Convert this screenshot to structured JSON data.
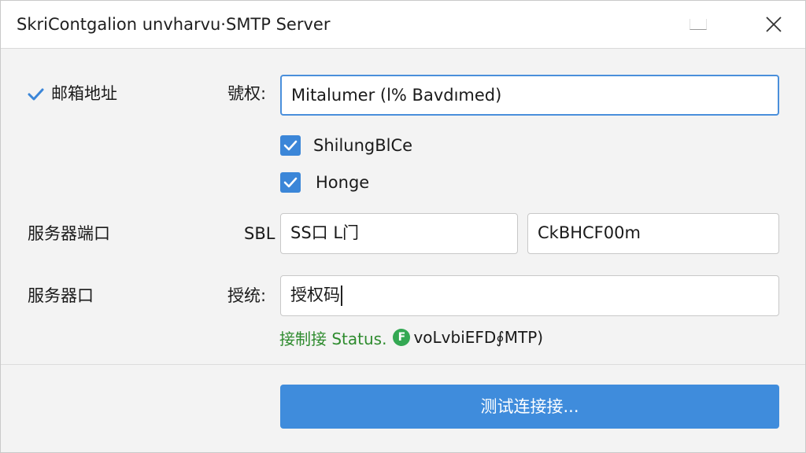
{
  "window": {
    "title": "SkriContgalion unvharvu·SMTP Server",
    "maximize_icon": "maximize-icon",
    "close_icon": "close-icon"
  },
  "form": {
    "email_section_label": "邮箱地址",
    "email_field_label": "號权:",
    "email_value": "Mitalumer (l% Bavdımed)",
    "checkboxes": [
      {
        "label": "ShilungBlCe",
        "checked": true
      },
      {
        "label": "Honge",
        "checked": true
      }
    ],
    "port_section_label": "服务器端口",
    "port_field_label": "SBL",
    "security_value": "SS口 L门",
    "port_value": "CkBHCF00m",
    "auth_section_label": "服务器口",
    "auth_field_label": "授统:",
    "auth_value": "授权码"
  },
  "status": {
    "prefix": "接制接 Status.",
    "icon_letter": "F",
    "text": "voLvbiEFD∮MTP)",
    "color": "#2e8b2e"
  },
  "actions": {
    "test_button_label": "测试连接接..."
  },
  "colors": {
    "accent": "#3f8cdc",
    "focus_border": "#4a8fdb",
    "success": "#34a853"
  }
}
